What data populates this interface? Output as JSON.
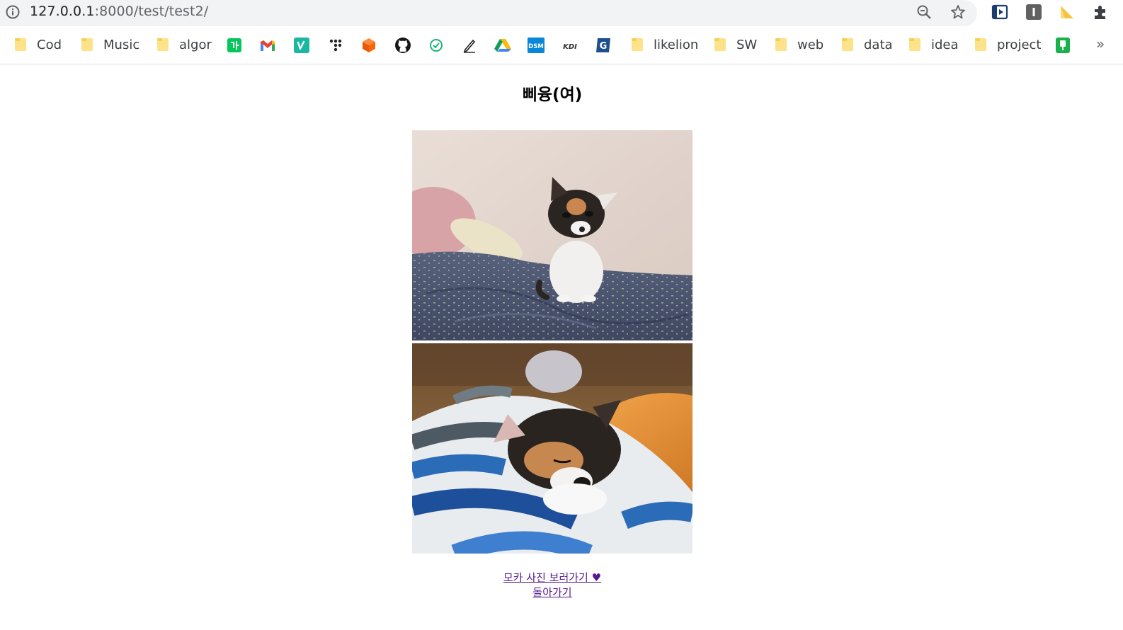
{
  "browser": {
    "url_host": "127.0.0.1",
    "url_path": ":8000/test/test2/",
    "bookmarks": {
      "cod": "Cod",
      "music": "Music",
      "algor": "algor",
      "likelion": "likelion",
      "sw": "SW",
      "web": "web",
      "data": "data",
      "idea": "idea",
      "project": "project",
      "overflow": "»"
    }
  },
  "page": {
    "title": "삐융(여)",
    "photos": [
      {
        "subject": "calico kitten sitting on a blue blanket"
      },
      {
        "subject": "calico kitten sleeping on a blue plaid blanket"
      }
    ],
    "links": {
      "moka": "모카 사진 보러가기 ♥",
      "back": "돌아가기"
    },
    "link_color": "#551a8b"
  }
}
